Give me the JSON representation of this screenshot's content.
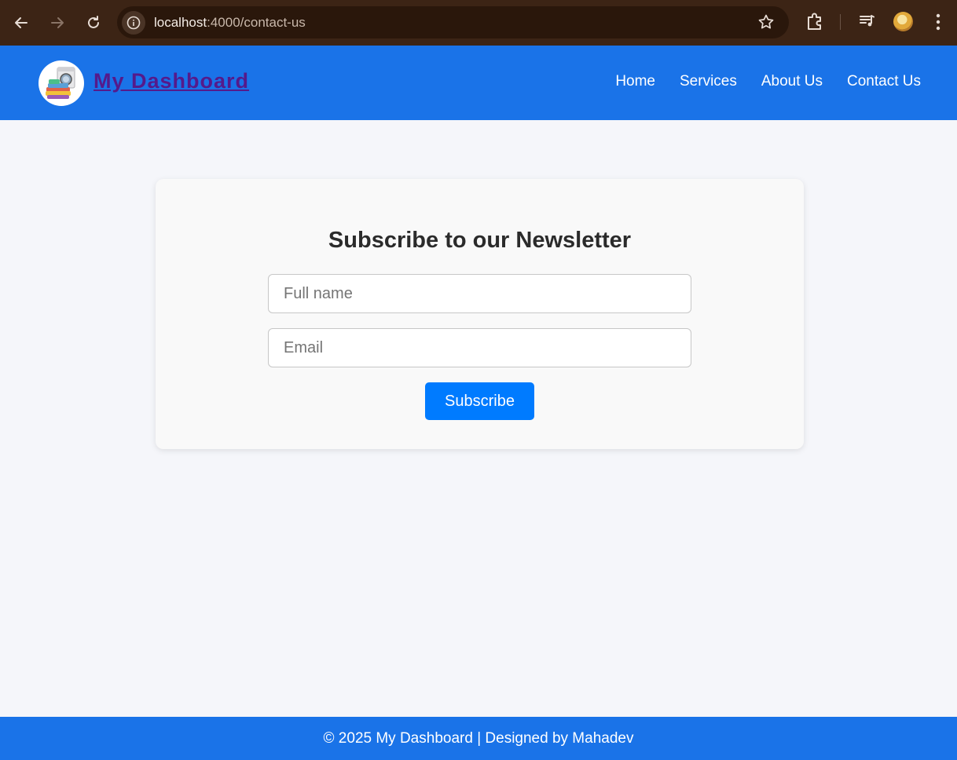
{
  "browser": {
    "url_host": "localhost",
    "url_path": ":4000/contact-us"
  },
  "header": {
    "brand": "My Dashboard",
    "nav": [
      "Home",
      "Services",
      "About Us",
      "Contact Us"
    ]
  },
  "newsletter": {
    "title": "Subscribe to our Newsletter",
    "name_placeholder": "Full name",
    "email_placeholder": "Email",
    "submit_label": "Subscribe"
  },
  "footer": {
    "text": "© 2025 My Dashboard | Designed by Mahadev"
  },
  "colors": {
    "header_bg": "#1a73e8",
    "button_bg": "#007bff",
    "brand_text": "#551a8b"
  },
  "icons": [
    "back-arrow-icon",
    "forward-arrow-icon",
    "reload-icon",
    "info-icon",
    "star-icon",
    "extensions-icon",
    "media-icon",
    "profile-avatar",
    "kebab-menu-icon",
    "washing-machine-logo"
  ]
}
